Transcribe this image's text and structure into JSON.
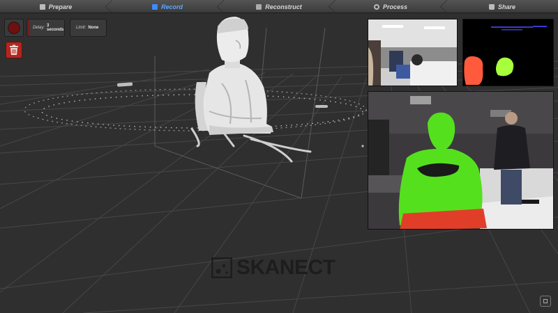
{
  "tabs": [
    {
      "label": "Prepare",
      "icon": "prepare-icon",
      "active": false
    },
    {
      "label": "Record",
      "icon": "record-icon",
      "active": true
    },
    {
      "label": "Reconstruct",
      "icon": "reconstruct-icon",
      "active": false
    },
    {
      "label": "Process",
      "icon": "process-icon",
      "active": false
    },
    {
      "label": "Share",
      "icon": "share-icon",
      "active": false
    }
  ],
  "controls": {
    "delay_label": "Delay:",
    "delay_value": "3 seconds",
    "limit_label": "Limit:",
    "limit_value": "None"
  },
  "logo": {
    "text": "SKANECT"
  },
  "colors": {
    "active_tab": "#5aa8ff",
    "record_button": "#6e1010",
    "trash_button": "#b3261e",
    "depth_red": "#ff5a3c",
    "depth_green": "#a8ff3c",
    "overlay_green": "#55e01e"
  }
}
